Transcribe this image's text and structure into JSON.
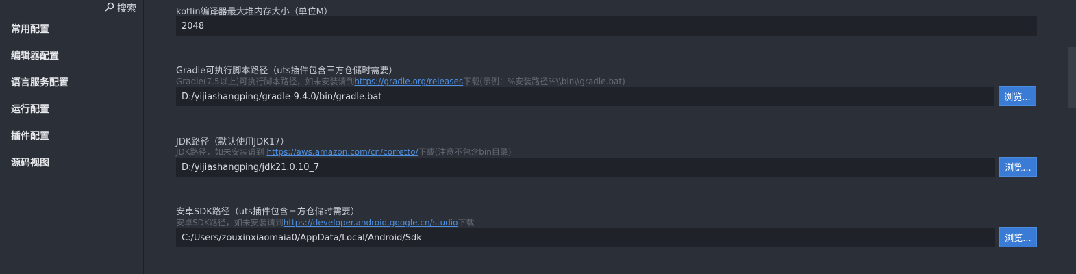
{
  "search": {
    "label": "搜索"
  },
  "sidebar": {
    "items": [
      {
        "label": "常用配置"
      },
      {
        "label": "编辑器配置"
      },
      {
        "label": "语言服务配置"
      },
      {
        "label": "运行配置"
      },
      {
        "label": "插件配置"
      },
      {
        "label": "源码视图"
      }
    ]
  },
  "settings": {
    "kotlin_heap": {
      "label": "kotlin编译器最大堆内存大小（单位M）",
      "value": "2048"
    },
    "gradle": {
      "label": "Gradle可执行脚本路径（uts插件包含三方仓储时需要）",
      "hint_prefix": "Gradle(7.5以上)可执行脚本路径，如未安装请到",
      "hint_link": "https://gradle.org/releases",
      "hint_suffix": "下载(示例：%安装路径%\\\\bin\\\\gradle.bat)",
      "value": "D:/yijiashangping/gradle-9.4.0/bin/gradle.bat",
      "browse_label": "浏览..."
    },
    "jdk": {
      "label": "JDK路径（默认使用JDK17）",
      "hint_prefix": "JDK路径，如未安装请到 ",
      "hint_link": "https://aws.amazon.com/cn/corretto/",
      "hint_suffix": "下载(注意不包含bin目录)",
      "value": "D:/yijiashangping/jdk21.0.10_7",
      "browse_label": "浏览..."
    },
    "android_sdk": {
      "label": "安卓SDK路径（uts插件包含三方仓储时需要）",
      "hint_prefix": "安卓SDK路径，如未安装请到",
      "hint_link": "https://developer.android.google.cn/studio",
      "hint_suffix": "下载",
      "value": "C:/Users/zouxinxiaomaia0/AppData/Local/Android/Sdk",
      "browse_label": "浏览..."
    }
  },
  "icons": {
    "search": "search-icon"
  },
  "colors": {
    "background": "#2b2f37",
    "input": "#1f2228",
    "accent": "#3a7bd5",
    "link": "#4d8fe0"
  }
}
